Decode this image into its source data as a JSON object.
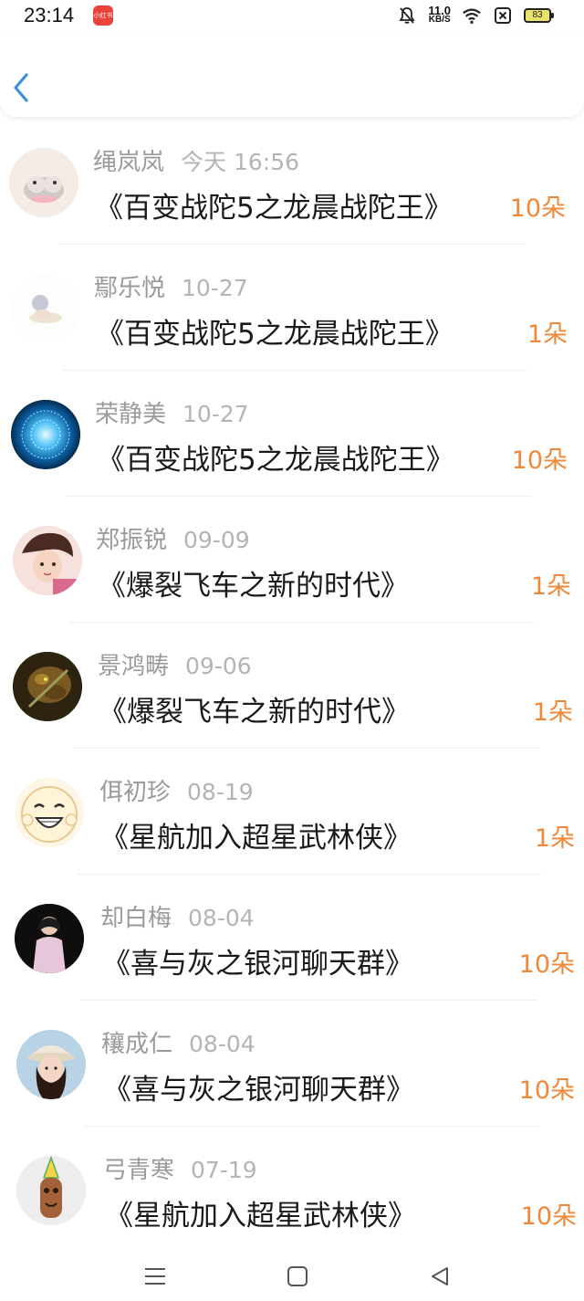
{
  "status_bar": {
    "time": "23:14",
    "app_icon_text": "小红书",
    "net_speed": "11.0",
    "net_unit": "KB/S",
    "battery": "83",
    "icons": [
      "app-icon",
      "mute-bell-icon",
      "wifi-icon",
      "sim-x-icon",
      "battery-icon"
    ]
  },
  "header": {
    "back_icon": "chevron-left-icon",
    "accent_color": "#3a8fe0"
  },
  "colors": {
    "count": "#f0883a",
    "name": "#9a9a9a",
    "date": "#b4b4b4",
    "title": "#1a1a1a"
  },
  "list": [
    {
      "name": "绳岚岚",
      "date": "今天 16:56",
      "title": "《百变战陀5之龙晨战陀王》",
      "count": "10朵",
      "avatar": "hamster-avatar"
    },
    {
      "name": "鄢乐悦",
      "date": "10-27",
      "title": "《百变战陀5之龙晨战陀王》",
      "count": "1朵",
      "avatar": "cartoon-sleeping-avatar"
    },
    {
      "name": "荣静美",
      "date": "10-27",
      "title": "《百变战陀5之龙晨战陀王》",
      "count": "10朵",
      "avatar": "blue-tunnel-avatar"
    },
    {
      "name": "郑振锐",
      "date": "09-09",
      "title": "《爆裂飞车之新的时代》",
      "count": "1朵",
      "avatar": "anime-boy-avatar"
    },
    {
      "name": "景鸿畴",
      "date": "09-06",
      "title": "《爆裂飞车之新的时代》",
      "count": "1朵",
      "avatar": "game-character-avatar"
    },
    {
      "name": "佴初珍",
      "date": "08-19",
      "title": "《星航加入超星武林侠》",
      "count": "1朵",
      "avatar": "smiley-face-avatar"
    },
    {
      "name": "却白梅",
      "date": "08-04",
      "title": "《喜与灰之银河聊天群》",
      "count": "10朵",
      "avatar": "portrait-dark-avatar"
    },
    {
      "name": "穰成仁",
      "date": "08-04",
      "title": "《喜与灰之银河聊天群》",
      "count": "10朵",
      "avatar": "girl-hat-avatar"
    },
    {
      "name": "弓青寒",
      "date": "07-19",
      "title": "《星航加入超星武林侠》",
      "count": "10朵",
      "avatar": "birthday-hat-avatar"
    }
  ],
  "nav": {
    "icons": [
      "menu-icon",
      "home-square-icon",
      "back-triangle-icon"
    ]
  }
}
